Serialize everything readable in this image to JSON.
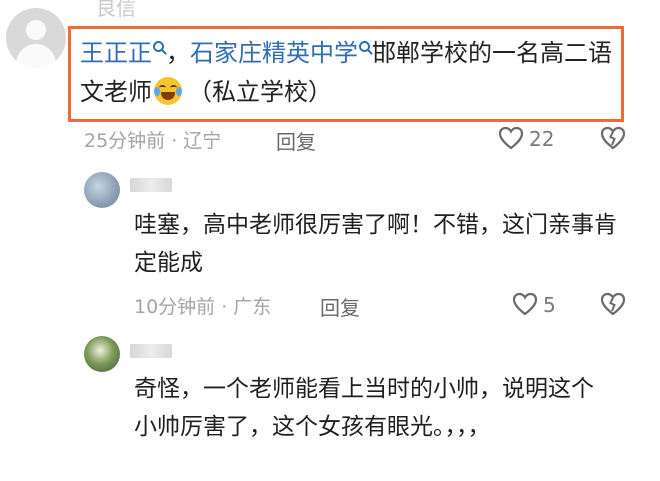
{
  "top_comment": {
    "username_partial": "良信",
    "link1": "王正正",
    "separator": "，",
    "link2": "石家庄精英中学",
    "text1": "邯郸学校的一名高二语文老师",
    "text2": "（私立学校）",
    "time_location": "25分钟前 · 辽宁",
    "reply_label": "回复",
    "like_count": "22"
  },
  "reply1": {
    "text": "哇塞，高中老师很厉害了啊！不错，这门亲事肯定能成",
    "time_location": "10分钟前 · 广东",
    "reply_label": "回复",
    "like_count": "5"
  },
  "reply2": {
    "text": "奇怪，一个老师能看上当时的小帅，说明这个小帅厉害了，这个女孩有眼光。，，，"
  },
  "colors": {
    "highlight_border": "#f06a38",
    "link": "#2f6db5"
  },
  "icons": [
    "search-icon",
    "laughing-emoji-icon",
    "heart-icon",
    "broken-heart-icon"
  ]
}
